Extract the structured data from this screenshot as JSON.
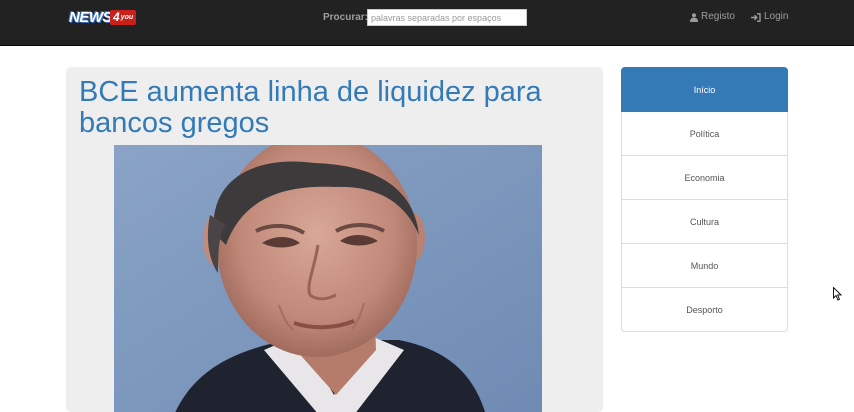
{
  "header": {
    "logo_text": "NEWS",
    "logo_badge": "4",
    "logo_badge_sub": "you",
    "search_label": "Procurar:",
    "search_placeholder": "palavras separadas por espaços",
    "registo_label": "Registo",
    "login_label": "Login",
    "registo_icon": "user-icon",
    "login_icon": "sign-in-icon"
  },
  "article": {
    "title": "BCE aumenta linha de liquidez para bancos gregos",
    "photo_icon": "portrait-photo"
  },
  "sidebar": {
    "items": [
      {
        "label": "Início",
        "active": true
      },
      {
        "label": "Política",
        "active": false
      },
      {
        "label": "Economia",
        "active": false
      },
      {
        "label": "Cultura",
        "active": false
      },
      {
        "label": "Mundo",
        "active": false
      },
      {
        "label": "Desporto",
        "active": false
      }
    ]
  },
  "colors": {
    "navbar": "#222222",
    "accent": "#337ab7",
    "panel": "#eeeeee",
    "logo_badge": "#c8201a"
  }
}
